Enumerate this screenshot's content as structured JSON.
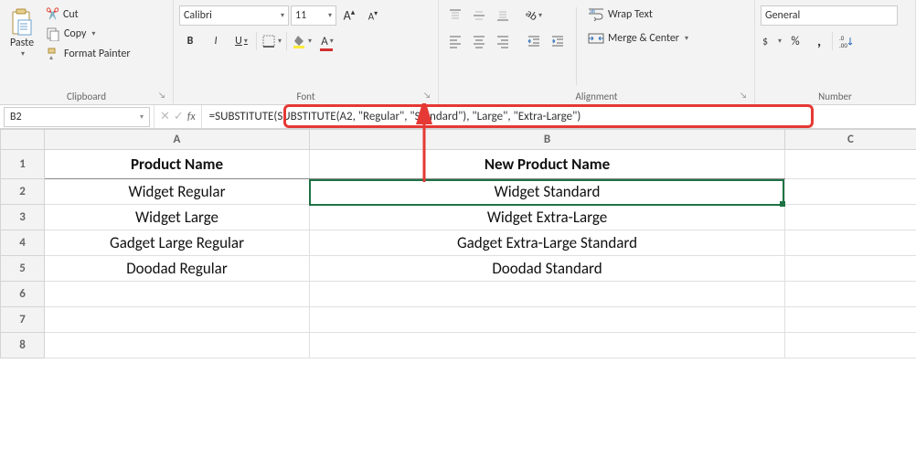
{
  "ribbon": {
    "clipboard": {
      "paste": "Paste",
      "cut": "Cut",
      "copy": "Copy",
      "format_painter": "Format Painter",
      "group_label": "Clipboard"
    },
    "font": {
      "font_name": "Calibri",
      "font_size": "11",
      "bold": "B",
      "italic": "I",
      "underline": "U",
      "group_label": "Font"
    },
    "alignment": {
      "wrap_text": "Wrap Text",
      "merge_center": "Merge & Center",
      "group_label": "Alignment"
    },
    "number": {
      "format": "General",
      "group_label": "Number"
    }
  },
  "formula_bar": {
    "name_box": "B2",
    "fx_label": "fx",
    "formula": "=SUBSTITUTE(SUBSTITUTE(A2, \"Regular\", \"Standard\"), \"Large\", \"Extra-Large\")"
  },
  "grid": {
    "col_headers": [
      "A",
      "B",
      "C"
    ],
    "row_headers": [
      "1",
      "2",
      "3",
      "4",
      "5",
      "6",
      "7",
      "8"
    ],
    "header_row": {
      "a": "Product Name",
      "b": "New Product Name"
    },
    "rows": [
      {
        "a": "Widget Regular",
        "b": "Widget Standard"
      },
      {
        "a": "Widget Large",
        "b": "Widget Extra-Large"
      },
      {
        "a": "Gadget Large Regular",
        "b": "Gadget Extra-Large Standard"
      },
      {
        "a": "Doodad Regular",
        "b": "Doodad Standard"
      }
    ]
  }
}
